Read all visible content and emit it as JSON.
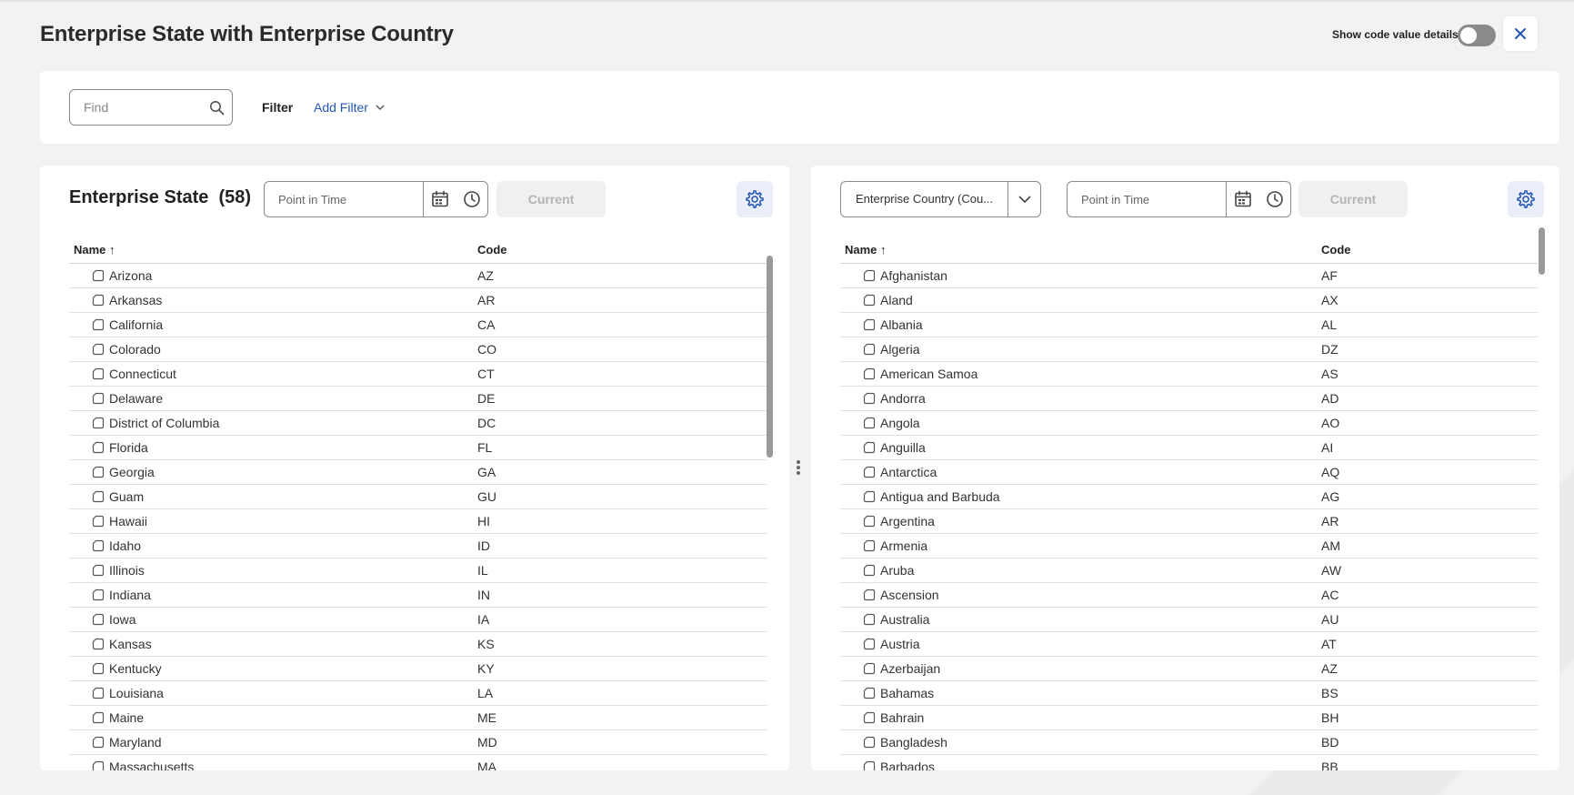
{
  "header": {
    "title": "Enterprise State with Enterprise Country",
    "toggle_label": "Show code value details"
  },
  "filter_bar": {
    "find_placeholder": "Find",
    "filter_label": "Filter",
    "add_filter_label": "Add Filter"
  },
  "left_panel": {
    "title": "Enterprise State",
    "count": "(58)",
    "point_in_time_placeholder": "Point in Time",
    "current_label": "Current",
    "columns": {
      "name": "Name",
      "sort_indicator": "↑",
      "code": "Code"
    },
    "rows": [
      {
        "name": "Arizona",
        "code": "AZ"
      },
      {
        "name": "Arkansas",
        "code": "AR"
      },
      {
        "name": "California",
        "code": "CA"
      },
      {
        "name": "Colorado",
        "code": "CO"
      },
      {
        "name": "Connecticut",
        "code": "CT"
      },
      {
        "name": "Delaware",
        "code": "DE"
      },
      {
        "name": "District of Columbia",
        "code": "DC"
      },
      {
        "name": "Florida",
        "code": "FL"
      },
      {
        "name": "Georgia",
        "code": "GA"
      },
      {
        "name": "Guam",
        "code": "GU"
      },
      {
        "name": "Hawaii",
        "code": "HI"
      },
      {
        "name": "Idaho",
        "code": "ID"
      },
      {
        "name": "Illinois",
        "code": "IL"
      },
      {
        "name": "Indiana",
        "code": "IN"
      },
      {
        "name": "Iowa",
        "code": "IA"
      },
      {
        "name": "Kansas",
        "code": "KS"
      },
      {
        "name": "Kentucky",
        "code": "KY"
      },
      {
        "name": "Louisiana",
        "code": "LA"
      },
      {
        "name": "Maine",
        "code": "ME"
      },
      {
        "name": "Maryland",
        "code": "MD"
      },
      {
        "name": "Massachusetts",
        "code": "MA"
      }
    ]
  },
  "right_panel": {
    "selector_value": "Enterprise Country (Cou...",
    "point_in_time_placeholder": "Point in Time",
    "current_label": "Current",
    "columns": {
      "name": "Name",
      "sort_indicator": "↑",
      "code": "Code"
    },
    "rows": [
      {
        "name": "Afghanistan",
        "code": "AF"
      },
      {
        "name": "Aland",
        "code": "AX"
      },
      {
        "name": "Albania",
        "code": "AL"
      },
      {
        "name": "Algeria",
        "code": "DZ"
      },
      {
        "name": "American Samoa",
        "code": "AS"
      },
      {
        "name": "Andorra",
        "code": "AD"
      },
      {
        "name": "Angola",
        "code": "AO"
      },
      {
        "name": "Anguilla",
        "code": "AI"
      },
      {
        "name": "Antarctica",
        "code": "AQ"
      },
      {
        "name": "Antigua and Barbuda",
        "code": "AG"
      },
      {
        "name": "Argentina",
        "code": "AR"
      },
      {
        "name": "Armenia",
        "code": "AM"
      },
      {
        "name": "Aruba",
        "code": "AW"
      },
      {
        "name": "Ascension",
        "code": "AC"
      },
      {
        "name": "Australia",
        "code": "AU"
      },
      {
        "name": "Austria",
        "code": "AT"
      },
      {
        "name": "Azerbaijan",
        "code": "AZ"
      },
      {
        "name": "Bahamas",
        "code": "BS"
      },
      {
        "name": "Bahrain",
        "code": "BH"
      },
      {
        "name": "Bangladesh",
        "code": "BD"
      },
      {
        "name": "Barbados",
        "code": "BB"
      }
    ]
  },
  "icons": {
    "close": "close-icon",
    "search": "search-icon",
    "chevron": "chevron-down-icon",
    "calendar": "calendar-icon",
    "clock": "clock-icon",
    "gear": "gear-icon",
    "row": "code-value-icon",
    "splitter": "drag-handle-icon"
  },
  "colors": {
    "accent": "#2456b8",
    "background": "#f2f2f2",
    "toggle_off": "#8a8a8a"
  },
  "toggle_state": "off"
}
